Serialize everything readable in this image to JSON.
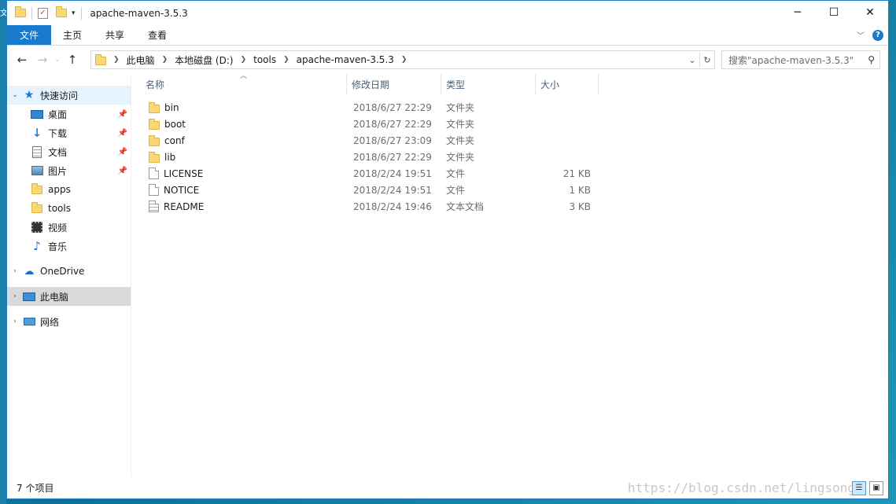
{
  "window": {
    "title": "apache-maven-3.5.3"
  },
  "ribbon": {
    "tabs": [
      "文件",
      "主页",
      "共享",
      "查看"
    ]
  },
  "address": {
    "crumbs": [
      "此电脑",
      "本地磁盘 (D:)",
      "tools",
      "apache-maven-3.5.3"
    ]
  },
  "search": {
    "placeholder": "搜索\"apache-maven-3.5.3\""
  },
  "nav": {
    "quick_access": "快速访问",
    "items": [
      {
        "label": "桌面",
        "icon": "desktop-icon",
        "pinned": true
      },
      {
        "label": "下载",
        "icon": "download-icon",
        "pinned": true
      },
      {
        "label": "文档",
        "icon": "document-icon",
        "pinned": true
      },
      {
        "label": "图片",
        "icon": "pictures-icon",
        "pinned": true
      },
      {
        "label": "apps",
        "icon": "folder-icon",
        "pinned": false
      },
      {
        "label": "tools",
        "icon": "folder-icon",
        "pinned": false
      },
      {
        "label": "视频",
        "icon": "video-icon",
        "pinned": false
      },
      {
        "label": "音乐",
        "icon": "music-icon",
        "pinned": false
      }
    ],
    "onedrive": "OneDrive",
    "this_pc": "此电脑",
    "network": "网络"
  },
  "columns": {
    "name": "名称",
    "date": "修改日期",
    "type": "类型",
    "size": "大小"
  },
  "files": [
    {
      "name": "bin",
      "date": "2018/6/27 22:29",
      "type": "文件夹",
      "size": "",
      "kind": "folder"
    },
    {
      "name": "boot",
      "date": "2018/6/27 22:29",
      "type": "文件夹",
      "size": "",
      "kind": "folder"
    },
    {
      "name": "conf",
      "date": "2018/6/27 23:09",
      "type": "文件夹",
      "size": "",
      "kind": "folder"
    },
    {
      "name": "lib",
      "date": "2018/6/27 22:29",
      "type": "文件夹",
      "size": "",
      "kind": "folder"
    },
    {
      "name": "LICENSE",
      "date": "2018/2/24 19:51",
      "type": "文件",
      "size": "21 KB",
      "kind": "file"
    },
    {
      "name": "NOTICE",
      "date": "2018/2/24 19:51",
      "type": "文件",
      "size": "1 KB",
      "kind": "file"
    },
    {
      "name": "README",
      "date": "2018/2/24 19:46",
      "type": "文本文档",
      "size": "3 KB",
      "kind": "text"
    }
  ],
  "status": {
    "count": "7 个项目"
  },
  "watermark": "https://blog.csdn.net/lingsong"
}
